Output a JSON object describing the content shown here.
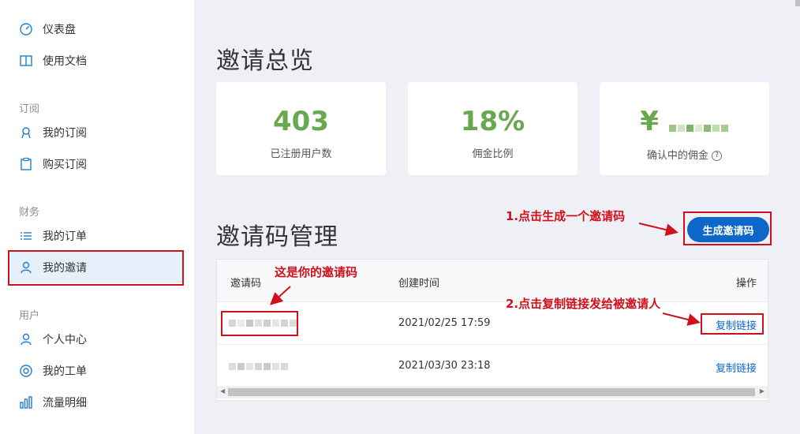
{
  "sidebar": {
    "items_top": [
      {
        "label": "仪表盘",
        "icon": "dashboard-icon"
      },
      {
        "label": "使用文档",
        "icon": "book-icon"
      }
    ],
    "section_subscribe": "订阅",
    "items_subscribe": [
      {
        "label": "我的订阅",
        "icon": "user-badge-icon"
      },
      {
        "label": "购买订阅",
        "icon": "clipboard-icon"
      }
    ],
    "section_finance": "财务",
    "items_finance": [
      {
        "label": "我的订单",
        "icon": "list-icon"
      },
      {
        "label": "我的邀请",
        "icon": "users-icon",
        "active": true
      }
    ],
    "section_user": "用户",
    "items_user": [
      {
        "label": "个人中心",
        "icon": "person-icon"
      },
      {
        "label": "我的工单",
        "icon": "lifebuoy-icon"
      },
      {
        "label": "流量明细",
        "icon": "bar-chart-icon"
      }
    ]
  },
  "overview": {
    "title": "邀请总览",
    "cards": [
      {
        "value": "403",
        "label": "已注册用户数"
      },
      {
        "value": "18%",
        "label": "佣金比例"
      },
      {
        "value": "¥",
        "label": "确认中的佣金"
      }
    ]
  },
  "codes": {
    "title": "邀请码管理",
    "generate_button": "生成邀请码",
    "headers": {
      "code": "邀请码",
      "created": "创建时间",
      "action": "操作"
    },
    "rows": [
      {
        "created": "2021/02/25 17:59",
        "action": "复制链接"
      },
      {
        "created": "2021/03/30 23:18",
        "action": "复制链接"
      }
    ]
  },
  "annotations": {
    "step1": "1.点击生成一个邀请码",
    "code_hint": "这是你的邀请码",
    "step2": "2.点击复制链接发给被邀请人"
  },
  "colors": {
    "accent": "#0c67c8",
    "value_green": "#6aa84f",
    "annotation_red": "#d0111b"
  }
}
